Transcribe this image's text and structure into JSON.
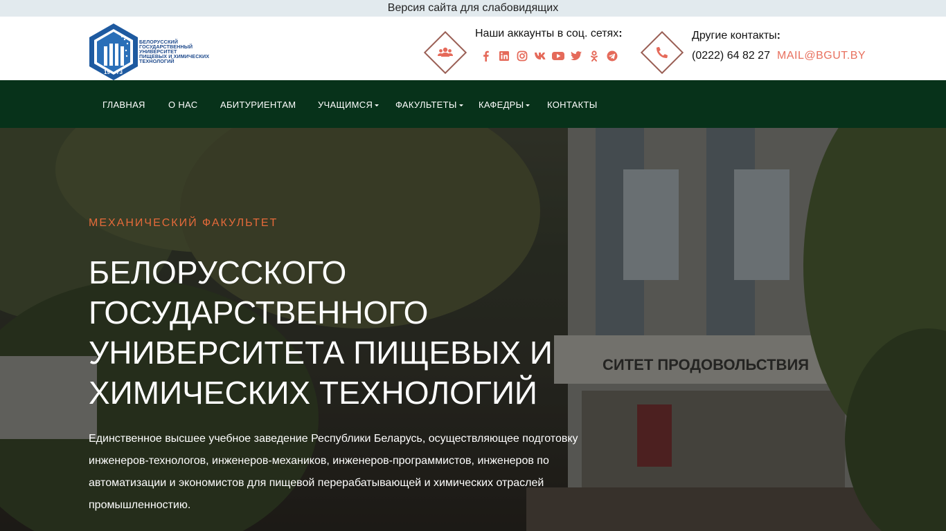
{
  "topbar": {
    "label": "Версия сайта для слабовидящих"
  },
  "logo": {
    "lines": [
      "БЕЛОРУССКИЙ",
      "ГОСУДАРСТВЕННЫЙ",
      "УНИВЕРСИТЕТ",
      "ПИЩЕВЫХ И ХИМИЧЕСКИХ",
      "ТЕХНОЛОГИЙ"
    ],
    "year_left": "19",
    "year_right": "73"
  },
  "header": {
    "social_title": "Наши аккаунты в соц. сетях",
    "social_colon": ":",
    "social_icons": [
      "facebook-icon",
      "linkedin-icon",
      "instagram-icon",
      "vk-icon",
      "youtube-icon",
      "twitter-icon",
      "odnoklassniki-icon",
      "telegram-icon"
    ],
    "contacts_title": "Другие контакты",
    "contacts_colon": ":",
    "phone": "(0222) 64 82 27",
    "email": "MAIL@BGUT.BY",
    "accent_color": "#e8705e"
  },
  "nav": {
    "items": [
      {
        "label": "ГЛАВНАЯ",
        "has_dropdown": false
      },
      {
        "label": "О НАС",
        "has_dropdown": false
      },
      {
        "label": "АБИТУРИЕНТАМ",
        "has_dropdown": false
      },
      {
        "label": "УЧАЩИМСЯ",
        "has_dropdown": true
      },
      {
        "label": "ФАКУЛЬТЕТЫ",
        "has_dropdown": true
      },
      {
        "label": "КАФЕДРЫ",
        "has_dropdown": true
      },
      {
        "label": "КОНТАКТЫ",
        "has_dropdown": false
      }
    ],
    "background": "#07321a"
  },
  "hero": {
    "kicker": "МЕХАНИЧЕСКИЙ ФАКУЛЬТЕТ",
    "headline": "БЕЛОРУССКОГО ГОСУДАРСТВЕННОГО УНИВЕРСИТЕТА ПИЩЕВЫХ И ХИМИЧЕСКИХ ТЕХНОЛОГИЙ",
    "description": "Единственное высшее учебное заведение Республики Беларусь, осуществляющее подготовку инженеров-технологов, инженеров-механиков, инженеров-программистов, инженеров по автоматизации и экономистов для пищевой перерабатывающей и химических отраслей промышленностию.",
    "building_sign": "СИТЕТ ПРОДОВОЛЬСТВИЯ"
  }
}
